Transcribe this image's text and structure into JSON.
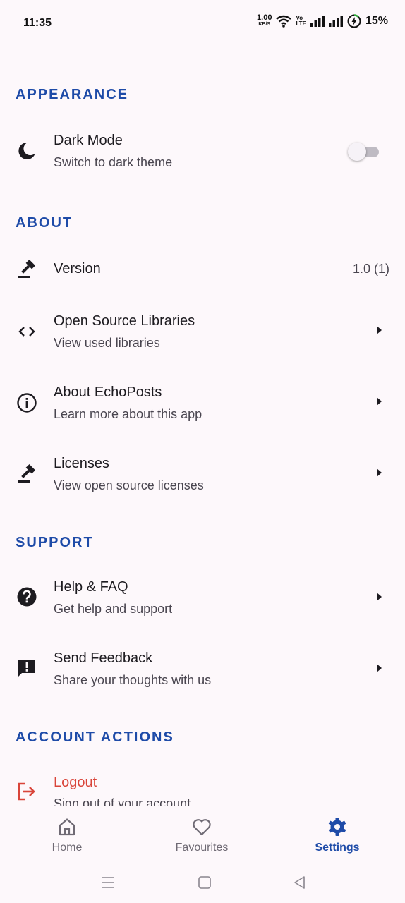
{
  "status": {
    "time": "11:35",
    "net_speed": "1.00",
    "net_unit": "KB/S",
    "volte_top": "Vo",
    "volte_bottom": "LTE",
    "battery": "15%"
  },
  "sections": {
    "appearance": "APPEARANCE",
    "about": "ABOUT",
    "support": "SUPPORT",
    "account": "ACCOUNT ACTIONS"
  },
  "items": {
    "dark_mode": {
      "title": "Dark Mode",
      "subtitle": "Switch to dark theme",
      "icon": "moon-icon",
      "toggle_on": false
    },
    "version": {
      "title": "Version",
      "value": "1.0 (1)",
      "icon": "gavel-icon"
    },
    "oss": {
      "title": "Open Source Libraries",
      "subtitle": "View used libraries",
      "icon": "code-icon"
    },
    "about_app": {
      "title": "About EchoPosts",
      "subtitle": "Learn more about this app",
      "icon": "info-icon"
    },
    "licenses": {
      "title": "Licenses",
      "subtitle": "View open source licenses",
      "icon": "gavel-icon"
    },
    "help": {
      "title": "Help & FAQ",
      "subtitle": "Get help and support",
      "icon": "help-icon"
    },
    "feedback": {
      "title": "Send Feedback",
      "subtitle": "Share your thoughts with us",
      "icon": "feedback-icon"
    },
    "logout": {
      "title": "Logout",
      "subtitle": "Sign out of your account",
      "icon": "logout-icon",
      "color": "#d9453a"
    }
  },
  "nav": {
    "home": "Home",
    "favourites": "Favourites",
    "settings": "Settings",
    "active": "settings",
    "accent": "#1e4ba8"
  }
}
